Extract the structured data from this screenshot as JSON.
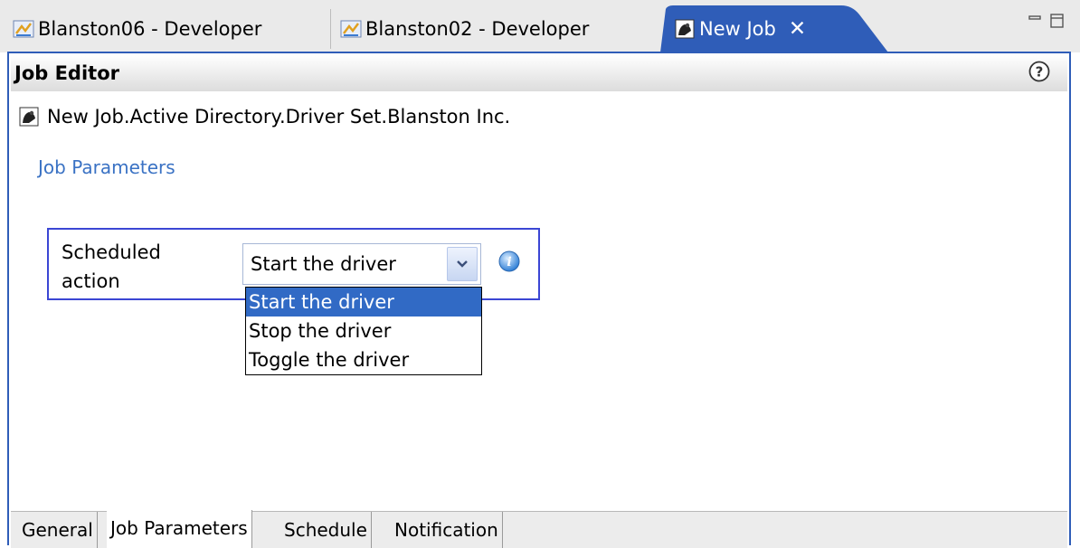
{
  "tabs": [
    {
      "label": "Blanston06 - Developer",
      "icon": "developer-perspective-icon",
      "active": false
    },
    {
      "label": "Blanston02 - Developer",
      "icon": "developer-perspective-icon",
      "active": false
    },
    {
      "label": "New Job",
      "icon": "job-icon",
      "active": true,
      "close_label": "✕"
    }
  ],
  "window_controls": {
    "minimize": "minimize-icon",
    "maximize": "maximize-icon"
  },
  "editor": {
    "title": "Job Editor",
    "help_icon": "help-icon",
    "object_path": "New Job.Active Directory.Driver Set.Blanston Inc.",
    "section": "Job Parameters",
    "parameter": {
      "label": "Scheduled action",
      "value": "Start the driver",
      "options": [
        "Start the driver",
        "Stop the driver",
        "Toggle the driver"
      ],
      "selected_index": 0,
      "dropdown_open": true,
      "info_icon": "info-icon"
    }
  },
  "page_tabs": [
    {
      "label": "General",
      "active": false
    },
    {
      "label": "Job Parameters",
      "active": true
    },
    {
      "label": "Schedule",
      "active": false
    },
    {
      "label": "Notification",
      "active": false
    }
  ],
  "colors": {
    "accent_blue": "#2f5db8",
    "selection": "#316ac5",
    "link": "#3a72c4",
    "param_border": "#3b46d4"
  }
}
